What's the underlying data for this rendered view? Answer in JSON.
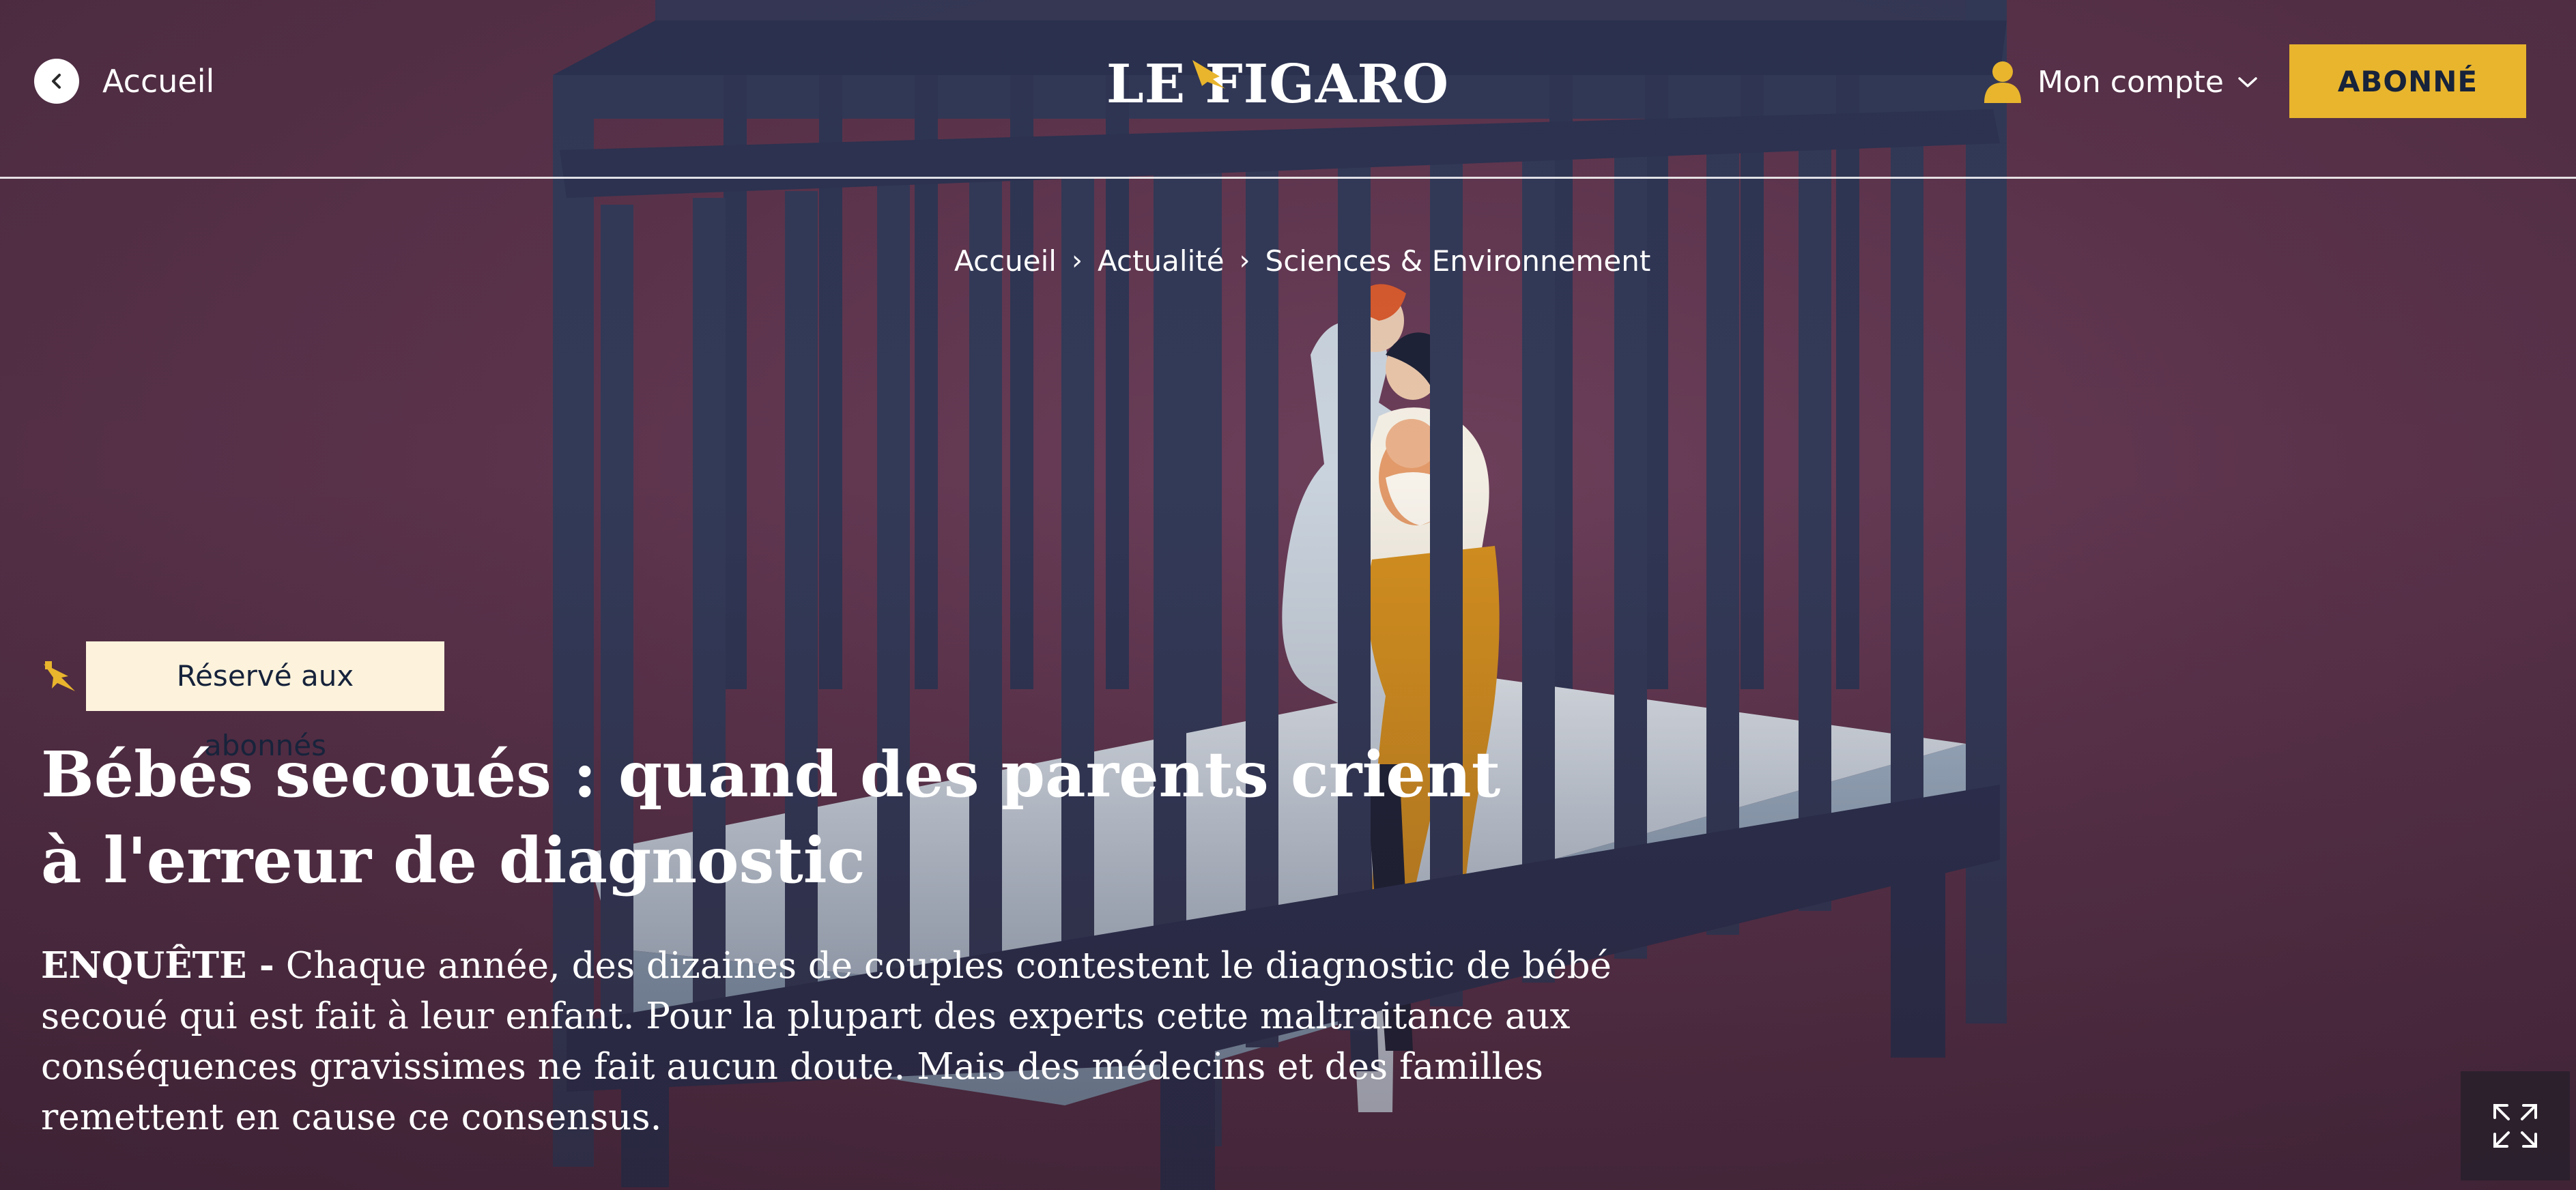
{
  "header": {
    "back_label": "Accueil",
    "logo_text": "LE FIGARO",
    "account_label": "Mon compte",
    "subscribe_label": "ABONNÉ"
  },
  "breadcrumb": {
    "items": [
      "Accueil",
      "Actualité",
      "Sciences & Environnement"
    ],
    "separator": "›"
  },
  "article": {
    "badge": "Réservé aux abonnés",
    "headline": "Bébés secoués : quand des parents crient à l'erreur de diagnostic",
    "kicker": "ENQUÊTE -",
    "standfirst": "Chaque année, des dizaines de couples contestent le diagnostic de bébé secoué qui est fait à leur enfant. Pour la plupart des experts cette maltraitance aux conséquences gravissimes ne fait aucun doute. Mais des médecins et des familles remettent en cause ce consensus."
  },
  "icons": {
    "back": "chevron-left-icon",
    "account": "user-icon",
    "account_dropdown": "chevron-down-icon",
    "premium": "figaro-bird-icon",
    "fullscreen": "fullscreen-icon"
  },
  "colors": {
    "background": "#5b334b",
    "accent": "#e8b52d",
    "navy": "#17233b",
    "badge_bg": "#fdf3dc",
    "crib": "#323a58",
    "mattress": "#c9d6e2"
  }
}
